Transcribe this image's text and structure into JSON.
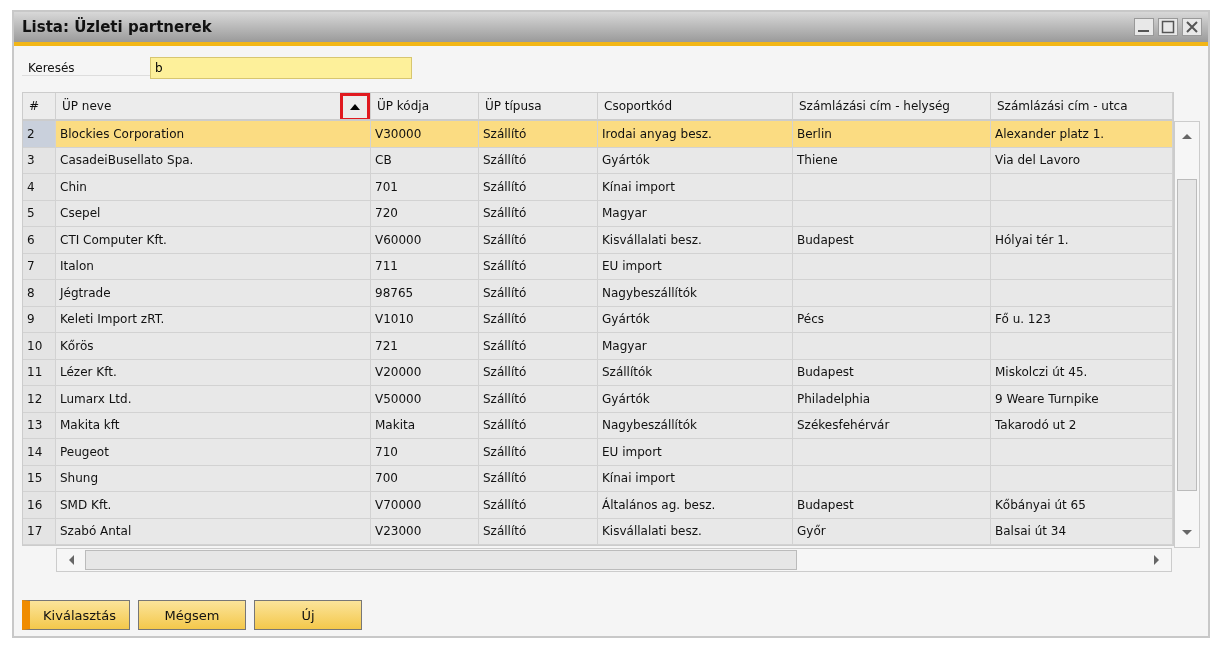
{
  "window": {
    "title": "Lista: Üzleti partnerek"
  },
  "search": {
    "label": "Keresés",
    "value": "b"
  },
  "table": {
    "columns": [
      {
        "label": "#",
        "sorted": false
      },
      {
        "label": "ÜP neve",
        "sorted": true
      },
      {
        "label": "ÜP kódja",
        "sorted": false
      },
      {
        "label": "ÜP típusa",
        "sorted": false
      },
      {
        "label": "Csoportkód",
        "sorted": false
      },
      {
        "label": "Számlázási cím - helység",
        "sorted": false
      },
      {
        "label": "Számlázási cím - utca",
        "sorted": false
      }
    ],
    "rows": [
      {
        "selected": true,
        "cells": [
          "2",
          "Blockies Corporation",
          "V30000",
          "Szállító",
          "Irodai anyag besz.",
          "Berlin",
          "Alexander platz 1."
        ]
      },
      {
        "selected": false,
        "cells": [
          "3",
          "CasadeiBusellato Spa.",
          "CB",
          "Szállító",
          "Gyártók",
          "Thiene",
          "Via del Lavoro"
        ]
      },
      {
        "selected": false,
        "cells": [
          "4",
          "Chin",
          "701",
          "Szállító",
          "Kínai import",
          "",
          ""
        ]
      },
      {
        "selected": false,
        "cells": [
          "5",
          "Csepel",
          "720",
          "Szállító",
          "Magyar",
          "",
          ""
        ]
      },
      {
        "selected": false,
        "cells": [
          "6",
          "CTI Computer Kft.",
          "V60000",
          "Szállító",
          "Kisvállalati besz.",
          "Budapest",
          "Hólyai tér 1."
        ]
      },
      {
        "selected": false,
        "cells": [
          "7",
          "Italon",
          "711",
          "Szállító",
          "EU import",
          "",
          ""
        ]
      },
      {
        "selected": false,
        "cells": [
          "8",
          "Jégtrade",
          "98765",
          "Szállító",
          "Nagybeszállítók",
          "",
          ""
        ]
      },
      {
        "selected": false,
        "cells": [
          "9",
          "Keleti Import zRT.",
          "V1010",
          "Szállító",
          "Gyártók",
          "Pécs",
          "Fő u. 123"
        ]
      },
      {
        "selected": false,
        "cells": [
          "10",
          "Kőrös",
          "721",
          "Szállító",
          "Magyar",
          "",
          ""
        ]
      },
      {
        "selected": false,
        "cells": [
          "11",
          "Lézer Kft.",
          "V20000",
          "Szállító",
          "Szállítók",
          "Budapest",
          "Miskolczi út 45."
        ]
      },
      {
        "selected": false,
        "cells": [
          "12",
          "Lumarx Ltd.",
          "V50000",
          "Szállító",
          "Gyártók",
          "Philadelphia",
          "9 Weare Turnpike"
        ]
      },
      {
        "selected": false,
        "cells": [
          "13",
          "Makita kft",
          "Makita",
          "Szállító",
          "Nagybeszállítók",
          "Székesfehérvár",
          "Takarodó ut 2"
        ]
      },
      {
        "selected": false,
        "cells": [
          "14",
          "Peugeot",
          "710",
          "Szállító",
          "EU import",
          "",
          ""
        ]
      },
      {
        "selected": false,
        "cells": [
          "15",
          "Shung",
          "700",
          "Szállító",
          "Kínai import",
          "",
          ""
        ]
      },
      {
        "selected": false,
        "cells": [
          "16",
          "SMD Kft.",
          "V70000",
          "Szállító",
          "Általános ag. besz.",
          "Budapest",
          "Kőbányai út 65"
        ]
      },
      {
        "selected": false,
        "cells": [
          "17",
          "Szabó Antal",
          "V23000",
          "Szállító",
          "Kisvállalati besz.",
          "Győr",
          "Balsai út 34"
        ]
      }
    ]
  },
  "buttons": [
    {
      "label": "Kiválasztás",
      "default": true
    },
    {
      "label": "Mégsem",
      "default": false
    },
    {
      "label": "Új",
      "default": false
    }
  ]
}
